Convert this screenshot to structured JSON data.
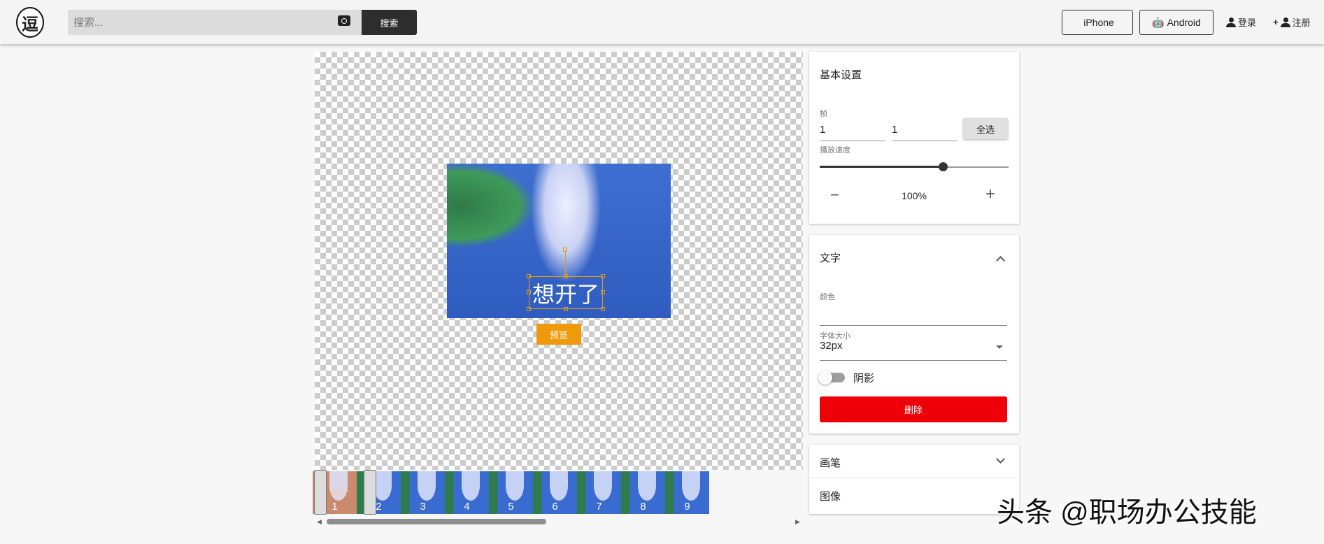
{
  "header": {
    "logo_glyph": "逗",
    "search_placeholder": "搜索...",
    "search_button": "搜索",
    "iphone": "iPhone",
    "android": "Android",
    "login": "登录",
    "register": "注册"
  },
  "editor": {
    "overlay_text": "想开了",
    "preview_button": "预览",
    "frames": [
      "1",
      "2",
      "3",
      "4",
      "5",
      "6",
      "7",
      "8"
    ],
    "selected_frame": 1,
    "frame1_overlay": "想开了"
  },
  "basic": {
    "title": "基本设置",
    "frame_label": "帧",
    "frame_start": "1",
    "frame_end": "1",
    "select_all": "全选",
    "speed_label": "播放速度",
    "speed_value": "100%",
    "speed_slider_step": 6,
    "speed_slider_steps": 9,
    "minus": "−",
    "plus": "+"
  },
  "text_panel": {
    "title": "文字",
    "color_label": "颜色",
    "font_size_label": "字体大小",
    "font_size_value": "32px",
    "shadow_label": "阴影",
    "shadow_on": false,
    "delete_button": "删除"
  },
  "brush_panel": {
    "title": "画笔"
  },
  "image_panel": {
    "title": "图像"
  },
  "watermark": "头条 @职场办公技能",
  "colors": {
    "delete": "#ee0008",
    "preview": "#ef9a0c",
    "selection": "#e39a1b"
  }
}
